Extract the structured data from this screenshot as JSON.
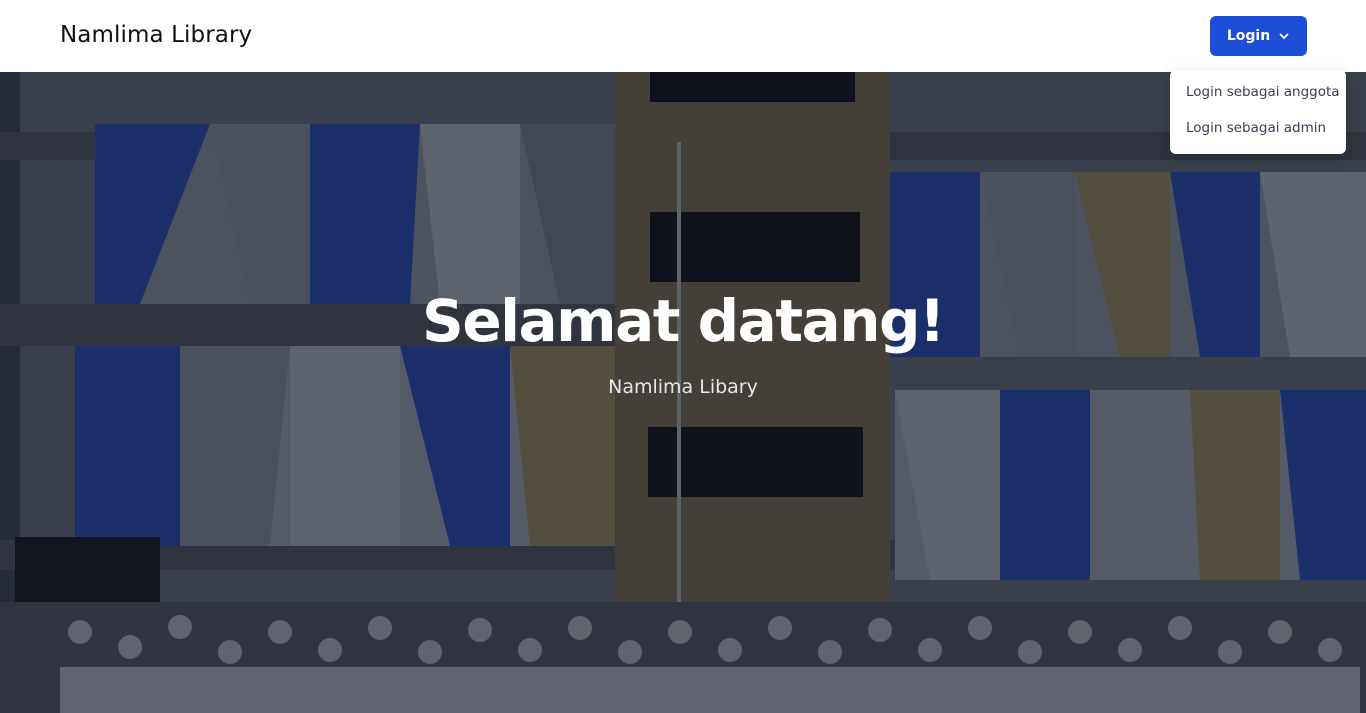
{
  "navbar": {
    "brand": "Namlima Library",
    "login_label": "Login",
    "chevron_icon": "chevron-down-icon",
    "accent_color": "#1d4ed8"
  },
  "dropdown": {
    "items": [
      {
        "label": "Login sebagai anggota"
      },
      {
        "label": "Login sebagai admin"
      }
    ]
  },
  "hero": {
    "title": "Selamat datang!",
    "subtitle": "Namlima Libary",
    "background": "school-building-photo"
  }
}
